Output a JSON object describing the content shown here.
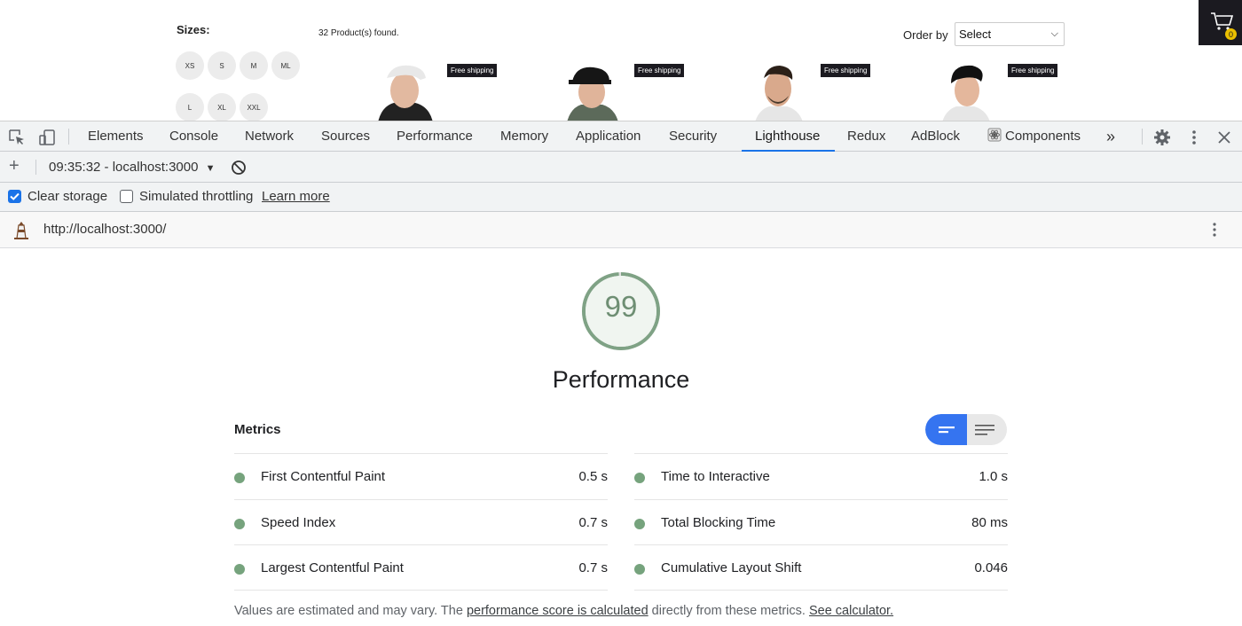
{
  "store": {
    "sizes_title": "Sizes:",
    "sizes": [
      "XS",
      "S",
      "M",
      "ML",
      "L",
      "XL",
      "XXL"
    ],
    "products_found": "32 Product(s) found.",
    "order_by_label": "Order by",
    "order_by_selected": "Select",
    "cart_count": "0",
    "products": [
      {
        "tag": "Free shipping"
      },
      {
        "tag": "Free shipping"
      },
      {
        "tag": "Free shipping"
      },
      {
        "tag": "Free shipping"
      }
    ]
  },
  "devtools": {
    "tabs": [
      "Elements",
      "Console",
      "Network",
      "Sources",
      "Performance",
      "Memory",
      "Application",
      "Security",
      "Lighthouse",
      "Redux",
      "AdBlock",
      "Components"
    ],
    "active_tab": "Lighthouse",
    "report_selector": "09:35:32 - localhost:3000",
    "clear_storage_label": "Clear storage",
    "clear_storage_checked": true,
    "simulated_throttling_label": "Simulated throttling",
    "simulated_throttling_checked": false,
    "learn_more": "Learn more",
    "url": "http://localhost:3000/"
  },
  "report": {
    "score": "99",
    "score_color": "#6e8e73",
    "category": "Performance",
    "metrics_heading": "Metrics",
    "metrics_left": [
      {
        "label": "First Contentful Paint",
        "value": "0.5 s"
      },
      {
        "label": "Speed Index",
        "value": "0.7 s"
      },
      {
        "label": "Largest Contentful Paint",
        "value": "0.7 s"
      }
    ],
    "metrics_right": [
      {
        "label": "Time to Interactive",
        "value": "1.0 s"
      },
      {
        "label": "Total Blocking Time",
        "value": "80 ms"
      },
      {
        "label": "Cumulative Layout Shift",
        "value": "0.046"
      }
    ],
    "footer_prefix": "Values are estimated and may vary. The ",
    "footer_link1": "performance score is calculated",
    "footer_middle": " directly from these metrics. ",
    "footer_link2": "See calculator."
  }
}
